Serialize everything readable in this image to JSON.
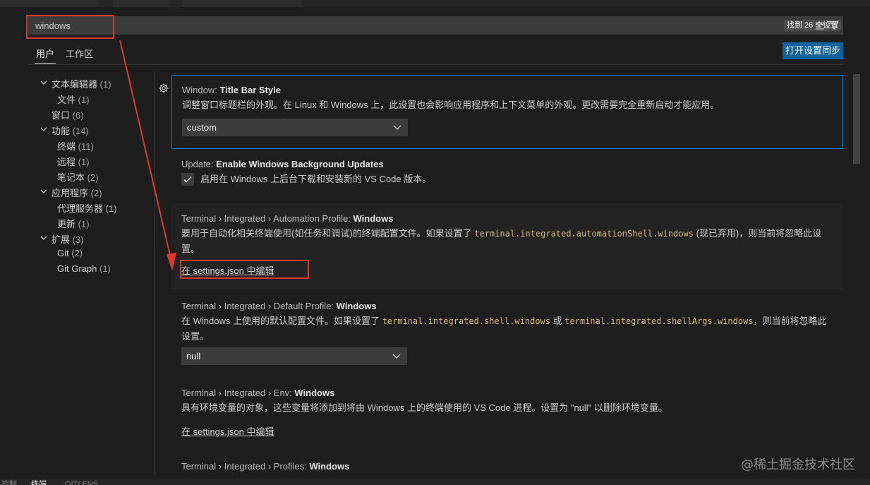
{
  "search": {
    "value": "windows",
    "found_text": "找到 26 个设置"
  },
  "tabs": [
    {
      "label": "用户",
      "active": true
    },
    {
      "label": "工作区",
      "active": false
    }
  ],
  "sync_button": "打开设置同步",
  "toc": [
    {
      "label": "文本编辑器",
      "count": "(1)",
      "expanded": true
    },
    {
      "label": "文件",
      "count": "(1)"
    },
    {
      "label": "窗口",
      "count": "(6)"
    },
    {
      "label": "功能",
      "count": "(14)",
      "expanded": true
    },
    {
      "label": "终端",
      "count": "(11)"
    },
    {
      "label": "远程",
      "count": "(1)"
    },
    {
      "label": "笔记本",
      "count": "(2)"
    },
    {
      "label": "应用程序",
      "count": "(2)",
      "expanded": true
    },
    {
      "label": "代理服务器",
      "count": "(1)"
    },
    {
      "label": "更新",
      "count": "(1)"
    },
    {
      "label": "扩展",
      "count": "(3)",
      "expanded": true
    },
    {
      "label": "Git",
      "count": "(2)"
    },
    {
      "label": "Git Graph",
      "count": "(1)"
    }
  ],
  "settings": {
    "title_bar": {
      "category": "Window: ",
      "name": "Title Bar Style",
      "desc": "调整窗口标题栏的外观。在 Linux 和 Windows 上，此设置也会影响应用程序和上下文菜单的外观。更改需要完全重新启动才能应用。",
      "value": "custom"
    },
    "update": {
      "category": "Update: ",
      "name": "Enable Windows Background Updates",
      "checkbox_label": "启用在 Windows 上后台下载和安装新的 VS Code 版本。",
      "checked": true
    },
    "automation": {
      "category": "Terminal › Integrated › Automation Profile: ",
      "name": "Windows",
      "desc_pre": "要用于自动化相关终端使用(如任务和调试)的终端配置文件。如果设置了 ",
      "code": "terminal.integrated.automationShell.windows",
      "desc_post": " (现已弃用)，则当前将忽略此设置。",
      "link": "在 settings.json 中编辑"
    },
    "default_profile": {
      "category": "Terminal › Integrated › Default Profile: ",
      "name": "Windows",
      "desc_pre": "在 Windows 上使用的默认配置文件。如果设置了 ",
      "code1": "terminal.integrated.shell.windows",
      "desc_mid": " 或 ",
      "code2": "terminal.integrated.shellArgs.windows",
      "desc_post": "，则当前将忽略此设置。",
      "value": "null"
    },
    "env": {
      "category": "Terminal › Integrated › Env: ",
      "name": "Windows",
      "desc": "具有环境变量的对象，这些变量将添加到将由 Windows 上的终端使用的 VS Code 进程。设置为 \"null\" 以删除环境变量。",
      "link": "在 settings.json 中编辑"
    },
    "profiles": {
      "category": "Terminal › Integrated › Profiles: ",
      "name": "Windows"
    }
  },
  "watermark": "@稀土掘金技术社区",
  "status": {
    "left1": "控制",
    "left2": "终端",
    "left3": "GITLENS"
  },
  "colors": {
    "accent": "#007fd4",
    "button": "#0e639c",
    "annotation": "#e0372f"
  }
}
